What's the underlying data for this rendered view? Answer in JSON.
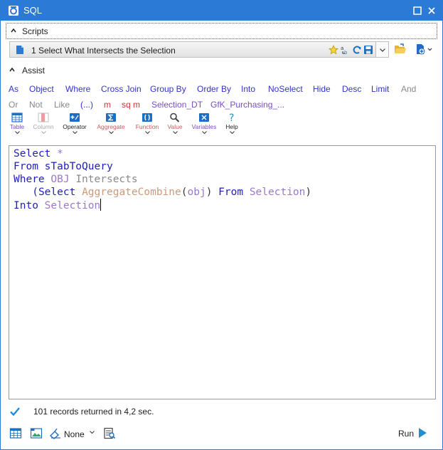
{
  "window": {
    "title": "SQL"
  },
  "scripts": {
    "header_label": "Scripts",
    "selected_script": "1 Select What Intersects the Selection"
  },
  "assist": {
    "header_label": "Assist",
    "row1": [
      "As",
      "Object",
      "Where",
      "Cross Join",
      "Group By",
      "Order By",
      "Into",
      "NoSelect",
      "Hide",
      "Desc",
      "Limit",
      "And"
    ],
    "row2": [
      "Or",
      "Not",
      "Like",
      "(...)",
      "m",
      "sq m",
      "Selection_DT",
      "GfK_Purchasing_..."
    ],
    "tools": [
      "Table",
      "Column",
      "Operator",
      "Aggregate",
      "Function",
      "Value",
      "Variables",
      "Help"
    ]
  },
  "editor": {
    "line1": {
      "kw": "Select",
      "rest": "*"
    },
    "line2": {
      "kw": "From",
      "table": "sTabToQuery"
    },
    "line3": {
      "kw": "Where",
      "col": "OBJ",
      "op": "Intersects"
    },
    "line4": {
      "open": "(",
      "kw1": "Select",
      "fn": "AggregateCombine",
      "p_open": "(",
      "arg": "obj",
      "p_close": ")",
      "kw2": "From",
      "tbl": "Selection",
      "close": ")"
    },
    "line5": {
      "kw": "Into",
      "tbl": "Selection"
    }
  },
  "status": {
    "text": "101 records returned in 4,2 sec."
  },
  "bottom": {
    "preview_value": "None",
    "run_label": "Run"
  },
  "colors": {
    "title_bar": "#2b7ad6",
    "keyword": "#1f1fb8",
    "assist_link": "#3333cc",
    "run_accent": "#1e8fd6"
  }
}
